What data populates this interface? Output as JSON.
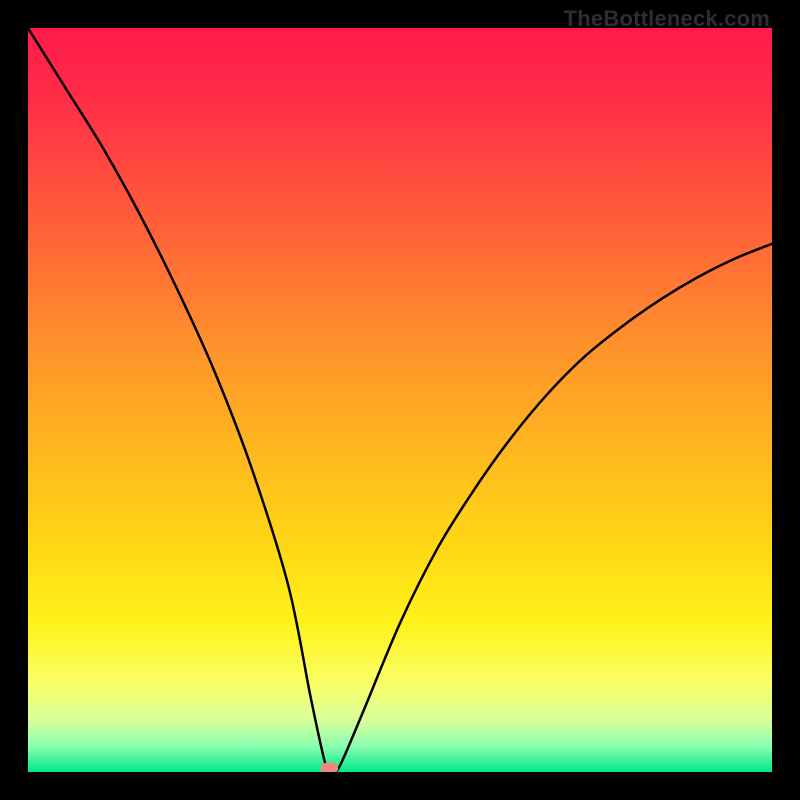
{
  "watermark": "TheBottleneck.com",
  "chart_data": {
    "type": "line",
    "title": "",
    "xlabel": "",
    "ylabel": "",
    "xlim": [
      0,
      100
    ],
    "ylim": [
      0,
      100
    ],
    "grid": false,
    "legend": false,
    "description": "V-shaped bottleneck curve on a vertical red-to-green gradient. The curve starts near the top-left (100%), falls steeply to ~0% at x≈40, then rises with decreasing slope toward the right edge reaching ~70%.",
    "series": [
      {
        "name": "bottleneck-curve",
        "x": [
          0,
          5,
          10,
          15,
          20,
          25,
          30,
          35,
          38,
          40,
          41,
          42,
          45,
          50,
          55,
          60,
          65,
          70,
          75,
          80,
          85,
          90,
          95,
          100
        ],
        "y": [
          100,
          92,
          84,
          75,
          65,
          54,
          41,
          25,
          10,
          1,
          0,
          1,
          8,
          20,
          30,
          38,
          45,
          51,
          56,
          60,
          63.5,
          66.5,
          69,
          71
        ]
      }
    ],
    "background_gradient_stops": [
      {
        "offset": 0.0,
        "color": "#ff1a4b"
      },
      {
        "offset": 0.1,
        "color": "#ff2e47"
      },
      {
        "offset": 0.25,
        "color": "#ff5b3a"
      },
      {
        "offset": 0.4,
        "color": "#ff8a2e"
      },
      {
        "offset": 0.55,
        "color": "#ffb321"
      },
      {
        "offset": 0.7,
        "color": "#ffd815"
      },
      {
        "offset": 0.8,
        "color": "#fff21a"
      },
      {
        "offset": 0.88,
        "color": "#faff66"
      },
      {
        "offset": 0.93,
        "color": "#d8ff99"
      },
      {
        "offset": 0.965,
        "color": "#8cffb0"
      },
      {
        "offset": 1.0,
        "color": "#00e889"
      }
    ],
    "marker": {
      "x": 40.5,
      "y": 0.5,
      "color": "#e98a82",
      "rx": 9,
      "ry": 6
    }
  }
}
